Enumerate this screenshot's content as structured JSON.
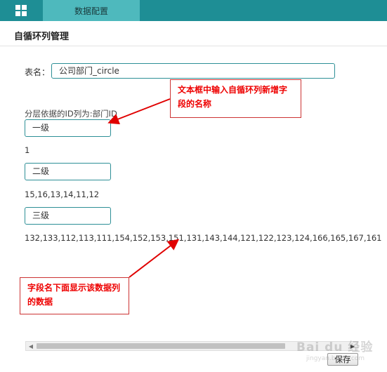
{
  "topbar": {
    "grid_icon": "grid-icon",
    "tab_label": "数据配置",
    "bg_color": "#1e8e95",
    "tab_color": "#4eb9bd"
  },
  "page": {
    "title": "自循环列管理"
  },
  "form": {
    "table_name_label": "表名：",
    "table_name_value": "公司部门_circle",
    "hierarchy_desc": "分层依据的ID列为:部门ID"
  },
  "levels": [
    {
      "name": "一级",
      "data": "1"
    },
    {
      "name": "二级",
      "data": "15,16,13,14,11,12"
    },
    {
      "name": "三级",
      "data": "132,133,112,113,111,154,152,153,151,131,143,144,121,122,123,124,166,165,167,161"
    }
  ],
  "annotations": {
    "callout_1": "文本框中输入自循环列新增字段的名称",
    "callout_2": "字段名下面显示该数据列的数据",
    "color": "#e00000"
  },
  "footer": {
    "save_label": "保存"
  },
  "watermark": {
    "main": "Bai du 经验",
    "sub": "jingyan.baidu.com"
  }
}
